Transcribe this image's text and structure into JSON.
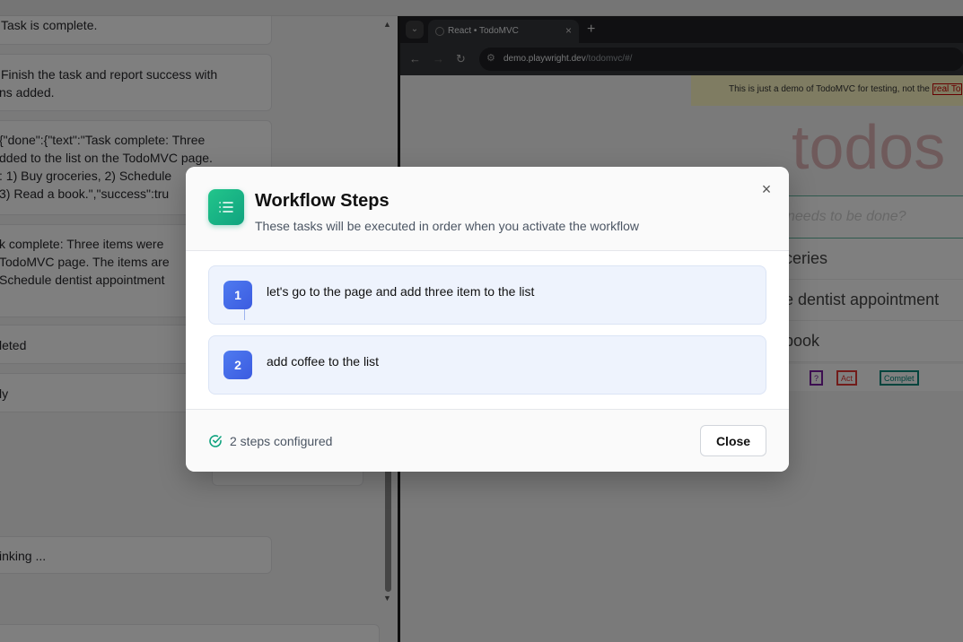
{
  "left_panel": {
    "cards": [
      {
        "lines": [
          "Task is complete."
        ]
      },
      {
        "lines": [
          "Finish the task and report success with",
          "ns added."
        ]
      },
      {
        "lines": [
          "{\"done\":{\"text\":\"Task complete: Three",
          "dded to the list on the TodoMVC page.",
          ": 1) Buy groceries, 2) Schedule",
          " 3) Read a book.\",\"success\":tru"
        ]
      },
      {
        "lines": [
          "k complete: Three items were",
          " TodoMVC page. The items are",
          "Schedule dentist appointment"
        ]
      },
      {
        "lines": [
          "leted"
        ]
      },
      {
        "lines": [
          "ly"
        ]
      },
      {
        "lines": [
          "inking ..."
        ]
      }
    ]
  },
  "browser": {
    "tab_title": "React • TodoMVC",
    "url_host": "demo.playwright.dev",
    "url_path": "/todomvc/#/",
    "banner_text": "This is just a demo of TodoMVC for testing, not the ",
    "banner_link": "real To",
    "app_title": "todos",
    "new_todo_placeholder": "needs to be done?",
    "todos": [
      "ceries",
      "e dentist appointment",
      "book"
    ],
    "filters": [
      "?",
      "Act",
      "Complet"
    ]
  },
  "modal": {
    "title": "Workflow Steps",
    "subtitle": "These tasks will be executed in order when you activate the workflow",
    "steps": [
      {
        "number": "1",
        "text": "let's go to the page and add three item to the list"
      },
      {
        "number": "2",
        "text": "add coffee to the list"
      }
    ],
    "footer_status": "2 steps configured",
    "close_label": "Close",
    "accent_color": "#10a37f",
    "step_color": "#3b5be0"
  }
}
